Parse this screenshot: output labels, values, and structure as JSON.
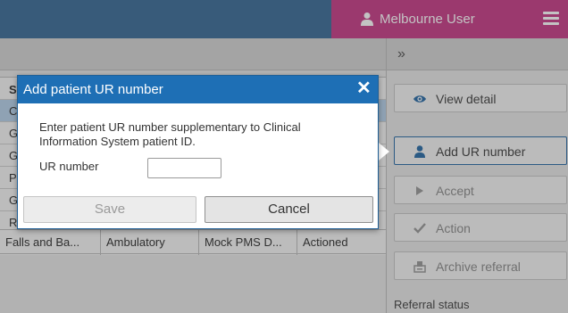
{
  "header": {
    "user_name": "Melbourne User",
    "user_icon": "user-icon",
    "menu_icon": "hamburger-menu-icon",
    "accent_color": "#c8418a"
  },
  "table": {
    "header_letter": "S",
    "row_letters": [
      "C",
      "G",
      "G",
      "P",
      "G",
      "R"
    ],
    "visible_row": [
      "Falls and Ba...",
      "Ambulatory",
      "Mock PMS D...",
      "Actioned"
    ]
  },
  "sidebar": {
    "collapse_label": "»",
    "buttons": [
      {
        "label": "View detail",
        "icon": "eye-icon"
      },
      {
        "label": "Add UR number",
        "icon": "user-icon"
      },
      {
        "label": "Accept",
        "icon": "play-icon"
      },
      {
        "label": "Action",
        "icon": "check-icon"
      },
      {
        "label": "Archive referral",
        "icon": "archive-icon"
      }
    ],
    "status_label": "Referral status"
  },
  "dialog": {
    "title": "Add patient UR number",
    "close_icon": "close-icon",
    "description": "Enter patient UR number supplementary to Clinical Information System patient ID.",
    "ur_label": "UR number",
    "ur_value": "",
    "save_label": "Save",
    "cancel_label": "Cancel",
    "header_color": "#1e6fb5"
  }
}
